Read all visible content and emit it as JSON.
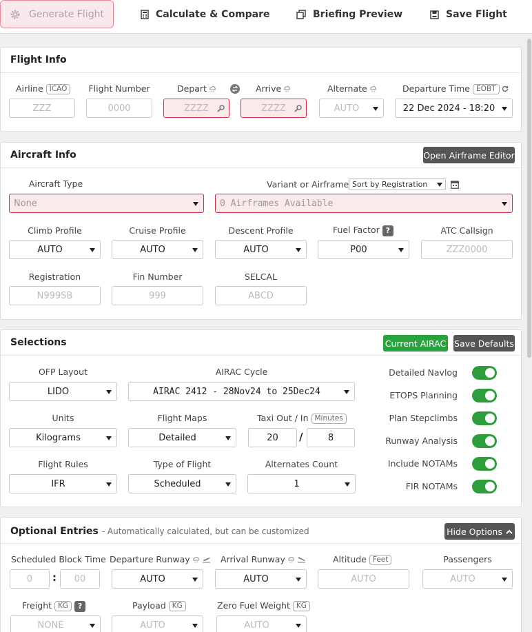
{
  "toolbar": {
    "generate": "Generate Flight",
    "calculate": "Calculate & Compare",
    "briefing": "Briefing Preview",
    "save": "Save Flight"
  },
  "flight_info": {
    "title": "Flight Info",
    "airline": {
      "label": "Airline",
      "tag": "ICAO",
      "placeholder": "ZZZ"
    },
    "flight_number": {
      "label": "Flight Number",
      "placeholder": "0000"
    },
    "depart": {
      "label": "Depart",
      "placeholder": "ZZZZ"
    },
    "arrive": {
      "label": "Arrive",
      "placeholder": "ZZZZ"
    },
    "alternate": {
      "label": "Alternate",
      "value": "AUTO"
    },
    "departure_time": {
      "label": "Departure Time",
      "tag": "EOBT",
      "value": "22 Dec 2024 - 18:20"
    }
  },
  "aircraft_info": {
    "title": "Aircraft Info",
    "editor_button": "Open Airframe Editor",
    "aircraft_type": {
      "label": "Aircraft Type",
      "value": "None"
    },
    "variant": {
      "label": "Variant or Airframe",
      "sort": "Sort by Registration",
      "value": "0 Airframes Available"
    },
    "climb": {
      "label": "Climb Profile",
      "value": "AUTO"
    },
    "cruise": {
      "label": "Cruise Profile",
      "value": "AUTO"
    },
    "descent": {
      "label": "Descent Profile",
      "value": "AUTO"
    },
    "fuel_factor": {
      "label": "Fuel Factor",
      "help": "?",
      "value": "P00"
    },
    "callsign": {
      "label": "ATC Callsign",
      "placeholder": "ZZZ0000"
    },
    "registration": {
      "label": "Registration",
      "placeholder": "N999SB"
    },
    "fin": {
      "label": "Fin Number",
      "placeholder": "999"
    },
    "selcal": {
      "label": "SELCAL",
      "placeholder": "ABCD"
    }
  },
  "selections": {
    "title": "Selections",
    "current_airac": "Current AIRAC",
    "save_defaults": "Save Defaults",
    "ofp_layout": {
      "label": "OFP Layout",
      "value": "LIDO"
    },
    "airac_cycle": {
      "label": "AIRAC Cycle",
      "value": "AIRAC 2412 - 28Nov24 to 25Dec24"
    },
    "units": {
      "label": "Units",
      "value": "Kilograms"
    },
    "flight_maps": {
      "label": "Flight Maps",
      "value": "Detailed"
    },
    "taxi": {
      "label": "Taxi Out / In",
      "tag": "Minutes",
      "out": "20",
      "sep": "/",
      "in": "8"
    },
    "flight_rules": {
      "label": "Flight Rules",
      "value": "IFR"
    },
    "type_of_flight": {
      "label": "Type of Flight",
      "value": "Scheduled"
    },
    "alternates_count": {
      "label": "Alternates Count",
      "value": "1"
    },
    "toggles": [
      {
        "label": "Detailed Navlog",
        "on": true
      },
      {
        "label": "ETOPS Planning",
        "on": true
      },
      {
        "label": "Plan Stepclimbs",
        "on": true
      },
      {
        "label": "Runway Analysis",
        "on": true
      },
      {
        "label": "Include NOTAMs",
        "on": true
      },
      {
        "label": "FIR NOTAMs",
        "on": true
      }
    ]
  },
  "optional": {
    "title": "Optional Entries",
    "subtitle": "- Automatically calculated, but can be customized",
    "hide_button": "Hide Options",
    "block_time": {
      "label": "Scheduled Block Time",
      "hours": "0",
      "colon": ":",
      "minutes": "00"
    },
    "dep_runway": {
      "label": "Departure Runway",
      "value": "AUTO"
    },
    "arr_runway": {
      "label": "Arrival Runway",
      "value": "AUTO"
    },
    "altitude": {
      "label": "Altitude",
      "tag": "Feet",
      "placeholder": "AUTO"
    },
    "passengers": {
      "label": "Passengers",
      "value": "AUTO"
    },
    "freight": {
      "label": "Freight",
      "tag": "KG",
      "help": "?",
      "value": "NONE"
    },
    "payload": {
      "label": "Payload",
      "tag": "KG",
      "value": "AUTO"
    },
    "zfw": {
      "label": "Zero Fuel Weight",
      "tag": "KG",
      "value": "AUTO"
    }
  },
  "colors": {
    "accent_green": "#28a33e",
    "error_red": "#d43044",
    "dark_button": "#555555"
  }
}
